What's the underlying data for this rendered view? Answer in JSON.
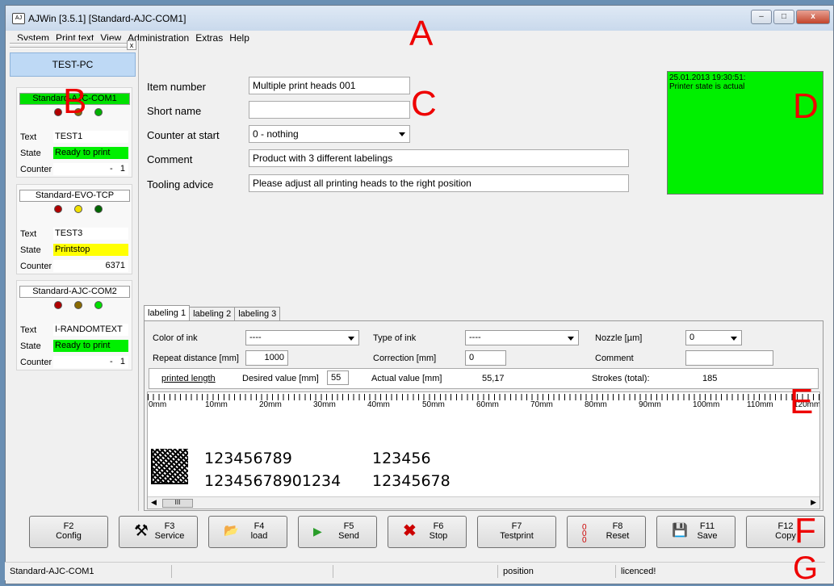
{
  "window": {
    "title": "AJWin [3.5.1]  [Standard-AJC-COM1]",
    "icon": "app-icon",
    "min_label": "–",
    "max_label": "□",
    "close_label": "x"
  },
  "menu": [
    "System",
    "Print text",
    "View",
    "Administration",
    "Extras",
    "Help"
  ],
  "sidebar": {
    "close_label": "x",
    "pc_name": "TEST-PC",
    "printers": [
      {
        "name": "Standard-AJC-COM1",
        "name_bg": "#00e000",
        "lights": [
          "#b00000",
          "#8a6a00",
          "#00b000"
        ],
        "text": "TEST1",
        "state": "Ready to print",
        "state_color": "#00f000",
        "counter": "1",
        "counter_prefix": "-"
      },
      {
        "name": "Standard-EVO-TCP",
        "name_bg": "#ffffff",
        "lights": [
          "#b00000",
          "#f0e000",
          "#006600"
        ],
        "text": "TEST3",
        "state": "Printstop",
        "state_color": "#ffff00",
        "counter": "6371",
        "counter_prefix": ""
      },
      {
        "name": "Standard-AJC-COM2",
        "name_bg": "#ffffff",
        "lights": [
          "#b00000",
          "#8a6a00",
          "#00e000"
        ],
        "text": "I-RANDOMTEXT",
        "state": "Ready to print",
        "state_color": "#00f000",
        "counter": "1",
        "counter_prefix": "-"
      }
    ],
    "labels": {
      "text": "Text",
      "state": "State",
      "counter": "Counter"
    }
  },
  "form": {
    "item_number": {
      "label": "Item number",
      "value": "Multiple print heads 001"
    },
    "short_name": {
      "label": "Short name",
      "value": ""
    },
    "counter_at_start": {
      "label": "Counter at start",
      "value": "0 - nothing"
    },
    "comment": {
      "label": "Comment",
      "value": "Product with 3 different labelings"
    },
    "tooling_advice": {
      "label": "Tooling advice",
      "value": "Please adjust all printing heads to the right position"
    }
  },
  "status_panel": {
    "timestamp": "25.01.2013 19:30:51:",
    "message": "Printer state is actual",
    "color": "#00f000"
  },
  "annotations": {
    "a": "A",
    "b": "B",
    "c": "C",
    "d": "D",
    "e": "E",
    "f": "F",
    "g": "G"
  },
  "tabs": [
    "labeling 1",
    "labeling 2",
    "labeling 3"
  ],
  "labeling": {
    "color_of_ink": {
      "label": "Color of ink",
      "value": "----"
    },
    "type_of_ink": {
      "label": "Type of ink",
      "value": "----"
    },
    "nozzle": {
      "label": "Nozzle [µm]",
      "value": "0"
    },
    "repeat_distance": {
      "label": "Repeat distance [mm]",
      "value": "1000"
    },
    "correction": {
      "label": "Correction [mm]",
      "value": "0"
    },
    "comment": {
      "label": "Comment",
      "value": ""
    },
    "printed_length": "printed length",
    "desired_value": {
      "label": "Desired value [mm]",
      "value": "55"
    },
    "actual_value": {
      "label": "Actual value [mm]",
      "value": "55,17"
    },
    "strokes": {
      "label": "Strokes (total):",
      "value": "185"
    }
  },
  "ruler": [
    "0mm",
    "10mm",
    "20mm",
    "30mm",
    "40mm",
    "50mm",
    "60mm",
    "70mm",
    "80mm",
    "90mm",
    "100mm",
    "110mm",
    "120mm"
  ],
  "print_preview": {
    "line1_a": "123456789",
    "line1_b": "123456",
    "line2_a": "12345678901234",
    "line2_b": "12345678",
    "scroll_thumb": "III",
    "scroll_left": "◀",
    "scroll_right": "▶"
  },
  "fkeys": [
    {
      "key": "F2",
      "label": "Config",
      "icon": ""
    },
    {
      "key": "F3",
      "label": "Service",
      "icon": "tools-icon"
    },
    {
      "key": "F4",
      "label": "load",
      "icon": "folder-open-icon"
    },
    {
      "key": "F5",
      "label": "Send",
      "icon": "play-icon"
    },
    {
      "key": "F6",
      "label": "Stop",
      "icon": "stop-x-icon"
    },
    {
      "key": "F7",
      "label": "Testprint",
      "icon": ""
    },
    {
      "key": "F8",
      "label": "Reset",
      "icon": "counter-reset-icon"
    },
    {
      "key": "F11",
      "label": "Save",
      "icon": "floppy-icon"
    },
    {
      "key": "F12",
      "label": "Copy",
      "icon": ""
    }
  ],
  "statusbar": {
    "printer": "Standard-AJC-COM1",
    "position": "position",
    "licence": "licenced!"
  }
}
